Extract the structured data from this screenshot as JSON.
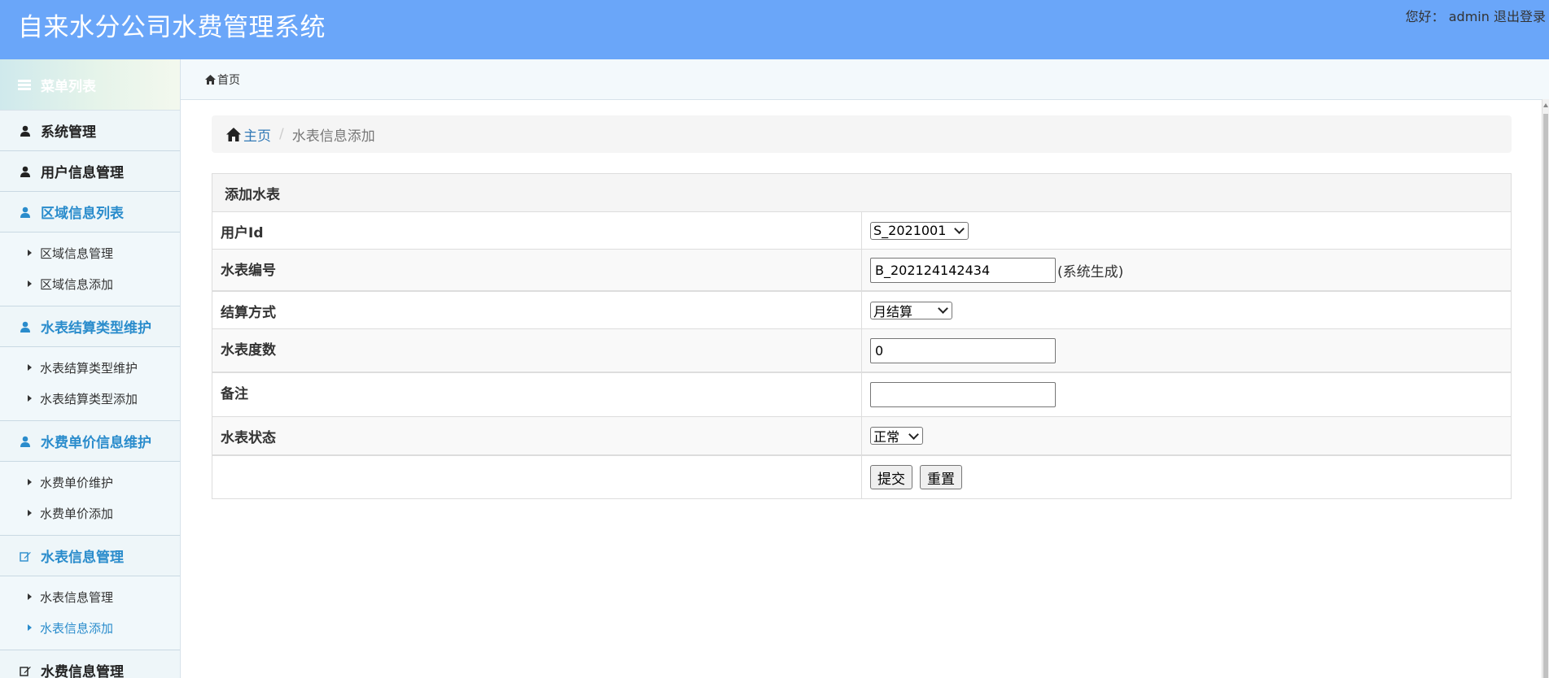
{
  "header": {
    "title": "自来水分公司水费管理系统",
    "greeting": "您好：",
    "username": "admin",
    "logout": "退出登录"
  },
  "sidebar": {
    "title": "菜单列表",
    "groups": [
      {
        "label": "系统管理"
      },
      {
        "label": "用户信息管理"
      },
      {
        "label": "区域信息列表",
        "items": [
          "区域信息管理",
          "区域信息添加"
        ]
      },
      {
        "label": "水表结算类型维护",
        "items": [
          "水表结算类型维护",
          "水表结算类型添加"
        ]
      },
      {
        "label": "水费单价信息维护",
        "items": [
          "水费单价维护",
          "水费单价添加"
        ]
      },
      {
        "label": "水表信息管理",
        "items": [
          "水表信息管理",
          "水表信息添加"
        ]
      },
      {
        "label": "水费信息管理"
      }
    ],
    "active_item": "水表信息添加"
  },
  "topbar": {
    "home_tab": "首页"
  },
  "breadcrumb": {
    "home": "主页",
    "current": "水表信息添加"
  },
  "form": {
    "title": "添加水表",
    "user_id": {
      "label": "用户Id",
      "value": "S_2021001"
    },
    "meter_no": {
      "label": "水表编号",
      "value": "B_202124142434",
      "hint": "(系统生成)"
    },
    "settlement": {
      "label": "结算方式",
      "value": "月结算"
    },
    "reading": {
      "label": "水表度数",
      "value": "0"
    },
    "remark": {
      "label": "备注",
      "value": ""
    },
    "status": {
      "label": "水表状态",
      "value": "正常"
    },
    "submit": "提交",
    "reset": "重置"
  },
  "colors": {
    "header_bg": "#6aa6f9",
    "link": "#337ab7",
    "menu_active": "#2a8ccc"
  }
}
